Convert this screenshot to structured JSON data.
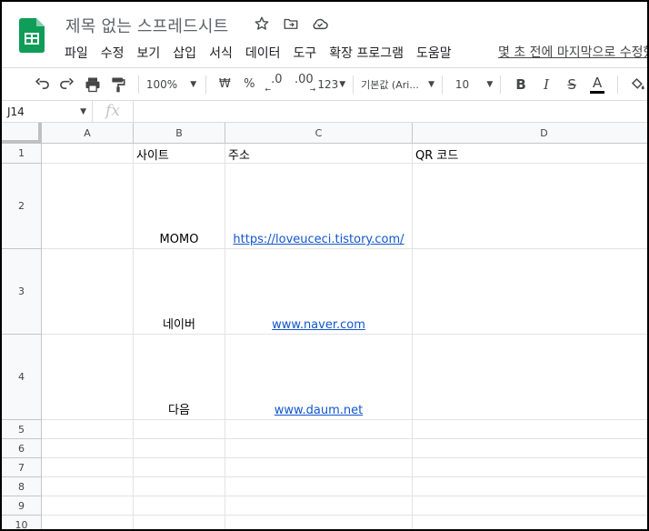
{
  "doc": {
    "title": "제목 없는 스프레드시트",
    "icons": [
      "star-icon",
      "move-to-folder-icon",
      "cloud-saved-icon"
    ]
  },
  "menu": [
    "파일",
    "수정",
    "보기",
    "삽입",
    "서식",
    "데이터",
    "도구",
    "확장 프로그램",
    "도움말"
  ],
  "last_edit": "몇 초 전에 마지막으로 수정했습니다",
  "toolbar": {
    "zoom": "100%",
    "currency": "₩",
    "percent": "%",
    "dec_decrease": ".0",
    "dec_increase": ".00",
    "more_formats": "123",
    "font": "기본값 (Ari...",
    "font_size": "10",
    "bold": "B",
    "italic": "I",
    "strike": "S",
    "text_color": "A"
  },
  "formula_bar": {
    "cell_ref": "J14",
    "fx": "fx",
    "value": ""
  },
  "sheet": {
    "columns": [
      "A",
      "B",
      "C",
      "D"
    ],
    "rows": [
      "1",
      "2",
      "3",
      "4",
      "5",
      "6",
      "7",
      "8",
      "9",
      "10"
    ],
    "headers": {
      "B": "사이트",
      "C": "주소",
      "D": "QR 코드"
    },
    "data": [
      {
        "site": "MOMO",
        "url": "https://loveuceci.tistory.com/"
      },
      {
        "site": "네이버",
        "url": "www.naver.com"
      },
      {
        "site": "다음",
        "url": "www.daum.net"
      }
    ]
  },
  "colors": {
    "brand_green": "#0f9d58",
    "link": "#1155cc",
    "header_bg": "#f8f9fa",
    "grid_line": "#e2e3e3"
  }
}
